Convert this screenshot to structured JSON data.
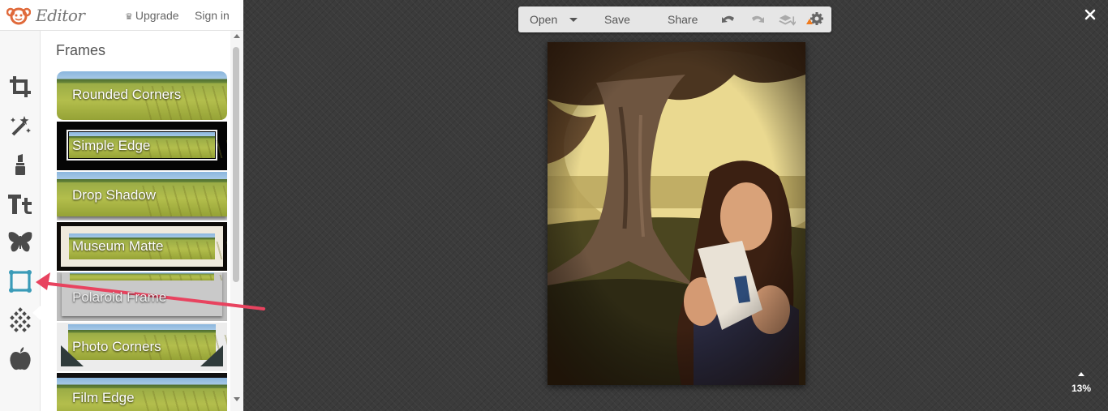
{
  "header": {
    "app_title": "Editor",
    "upgrade_label": "Upgrade",
    "signin_label": "Sign in"
  },
  "rail": {
    "tools": [
      {
        "name": "crop-icon"
      },
      {
        "name": "magic-wand-icon"
      },
      {
        "name": "lipstick-icon"
      },
      {
        "name": "text-icon"
      },
      {
        "name": "butterfly-icon"
      },
      {
        "name": "frame-icon",
        "active": true
      },
      {
        "name": "texture-icon"
      },
      {
        "name": "apple-icon"
      }
    ]
  },
  "panel": {
    "title": "Frames",
    "frames": [
      {
        "label": "Rounded Corners"
      },
      {
        "label": "Simple Edge"
      },
      {
        "label": "Drop Shadow"
      },
      {
        "label": "Museum Matte"
      },
      {
        "label": "Polaroid Frame"
      },
      {
        "label": "Photo Corners"
      },
      {
        "label": "Film Edge"
      }
    ]
  },
  "toolbar": {
    "open_label": "Open",
    "save_label": "Save",
    "share_label": "Share"
  },
  "zoom": {
    "label": "13%"
  },
  "colors": {
    "accent": "#3a9bb8",
    "annotation": "#e8435f",
    "canvas": "#3b3b3b",
    "logo": "#e06a3b"
  }
}
